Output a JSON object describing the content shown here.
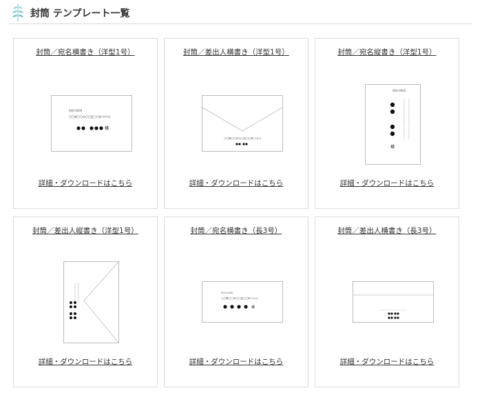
{
  "page": {
    "title": "封筒 テンプレート一覧"
  },
  "cards": [
    {
      "title": "封筒／宛名横書き（洋型1号）",
      "link": "詳細・ダウンロードはこちら"
    },
    {
      "title": "封筒／差出人横書き（洋型1号）",
      "link": "詳細・ダウンロードはこちら"
    },
    {
      "title": "封筒／宛名縦書き（洋型1号）",
      "link": "詳細・ダウンロードはこちら"
    },
    {
      "title": "封筒／差出人縦書き（洋型1号）",
      "link": "詳細・ダウンロードはこちら"
    },
    {
      "title": "封筒／宛名横書き（長3号）",
      "link": "詳細・ダウンロードはこちら"
    },
    {
      "title": "封筒／差出人横書き（長3号）",
      "link": "詳細・ダウンロードはこちら"
    }
  ],
  "thumbs": {
    "card1": {
      "zip": "000-0000",
      "address": "〇〇県〇〇市〇〇区〇〇町 0-0-0",
      "name_mark": "様"
    },
    "card2": {
      "address": "〇〇県〇〇市〇〇区〇〇町 0-0-0"
    },
    "card3": {
      "zip": "000-0000",
      "name_mark": "様"
    },
    "card5": {
      "zip": "000-0000",
      "address": "〇〇県〇〇市〇〇区〇〇町 0-0-0",
      "name_mark": "様"
    }
  },
  "colors": {
    "accent": "#8fcfd8",
    "text": "#333333",
    "border": "#dcdcdc"
  },
  "icons": {
    "header": "leaf-icon"
  }
}
